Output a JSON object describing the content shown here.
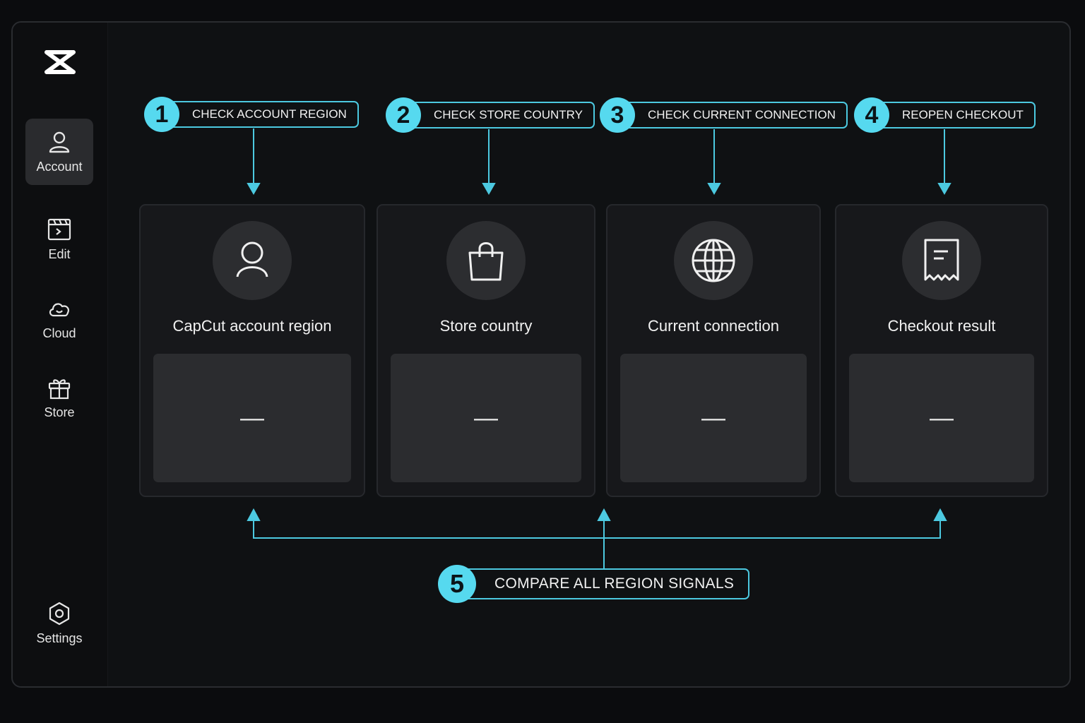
{
  "sidebar": {
    "logo": "capcut-logo",
    "items": [
      {
        "label": "Account",
        "icon": "user-icon",
        "active": true
      },
      {
        "label": "Edit",
        "icon": "clapper-icon",
        "active": false
      },
      {
        "label": "Cloud",
        "icon": "cloud-icon",
        "active": false
      },
      {
        "label": "Store",
        "icon": "gift-icon",
        "active": false
      }
    ],
    "settings": {
      "label": "Settings",
      "icon": "settings-icon"
    }
  },
  "steps": [
    {
      "number": "1",
      "label": "CHECK ACCOUNT REGION"
    },
    {
      "number": "2",
      "label": "CHECK STORE COUNTRY"
    },
    {
      "number": "3",
      "label": "CHECK CURRENT CONNECTION"
    },
    {
      "number": "4",
      "label": "REOPEN CHECKOUT"
    },
    {
      "number": "5",
      "label": "COMPARE ALL REGION SIGNALS"
    }
  ],
  "cards": [
    {
      "title": "CapCut account region",
      "value": "—",
      "icon": "user-icon"
    },
    {
      "title": "Store country",
      "value": "—",
      "icon": "shopping-bag-icon"
    },
    {
      "title": "Current connection",
      "value": "—",
      "icon": "globe-icon"
    },
    {
      "title": "Checkout result",
      "value": "—",
      "icon": "receipt-icon"
    }
  ],
  "colors": {
    "accent": "#56d9ef",
    "card": "#17181b",
    "background": "#0b0c0e"
  }
}
